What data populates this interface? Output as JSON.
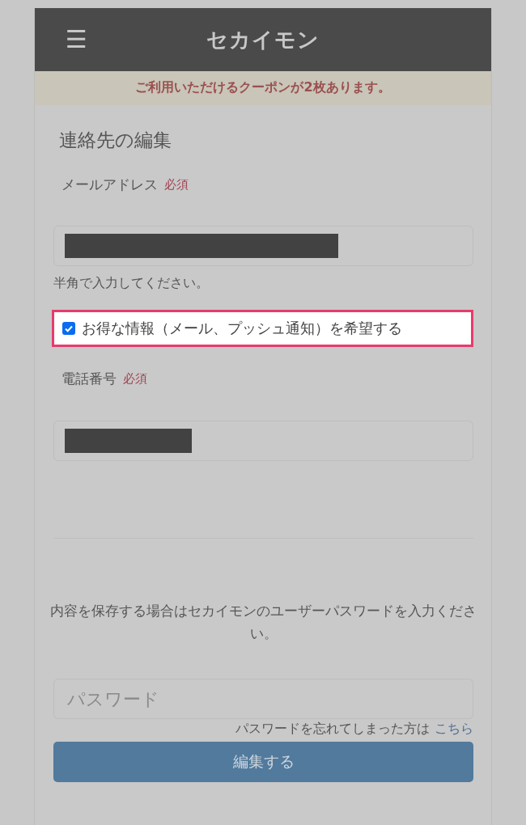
{
  "header": {
    "menu_icon": "☰",
    "logo": "セカイモン"
  },
  "coupon_notice": "ご利用いただけるクーポンが2枚あります。",
  "title": "連絡先の編集",
  "fields": [
    {
      "label": "メールアドレス",
      "required": "必須",
      "redacted": true,
      "hint": "半角で入力してください。"
    },
    {
      "label": "電話番号",
      "required": "必須",
      "redacted": true
    }
  ],
  "newsletter": {
    "label": "お得な情報（メール、プッシュ通知）を希望する",
    "checked": true,
    "highlighted": true
  },
  "password_prompt": "内容を保存する場合はセカイモンのユーザーパスワードを入力ください。",
  "password": {
    "placeholder": "パスワード"
  },
  "forgot": {
    "text": "パスワードを忘れてしまった方は",
    "link": "こちら"
  },
  "submit_button": "編集する"
}
